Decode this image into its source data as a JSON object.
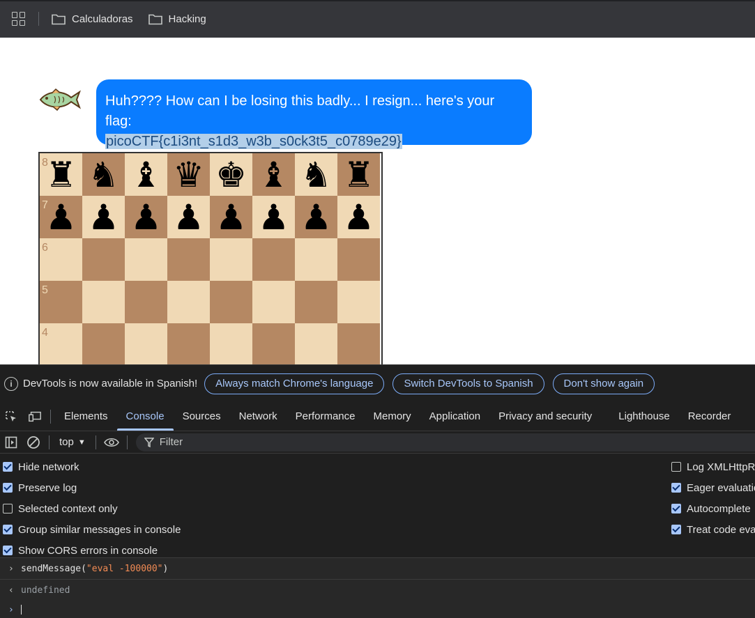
{
  "bookmarks": {
    "items": [
      {
        "label": "Calculadoras",
        "icon": "folder-icon"
      },
      {
        "label": "Hacking",
        "icon": "folder-icon"
      }
    ]
  },
  "chat": {
    "message": "Huh???? How can I be losing this badly... I resign... here's your flag:",
    "flag": "picoCTF{c1i3nt_s1d3_w3b_s0ck3t5_c0789e29}"
  },
  "board": {
    "rank_labels": [
      "8",
      "7",
      "6",
      "5",
      "4"
    ],
    "rank8": [
      "♜",
      "♞",
      "♝",
      "♛",
      "♚",
      "♝",
      "♞",
      "♜"
    ],
    "rank7": [
      "♟",
      "♟",
      "♟",
      "♟",
      "♟",
      "♟",
      "♟",
      "♟"
    ]
  },
  "devtools": {
    "info_message": "DevTools is now available in Spanish!",
    "info_buttons": [
      "Always match Chrome's language",
      "Switch DevTools to Spanish",
      "Don't show again"
    ],
    "tabs": [
      "Elements",
      "Console",
      "Sources",
      "Network",
      "Performance",
      "Memory",
      "Application",
      "Privacy and security",
      "Lighthouse",
      "Recorder"
    ],
    "active_tab": "Console",
    "context": "top",
    "filter_placeholder": "Filter",
    "settings_left": [
      {
        "label": "Hide network",
        "checked": true
      },
      {
        "label": "Preserve log",
        "checked": true
      },
      {
        "label": "Selected context only",
        "checked": false
      },
      {
        "label": "Group similar messages in console",
        "checked": true
      },
      {
        "label": "Show CORS errors in console",
        "checked": true
      }
    ],
    "settings_right": [
      {
        "label": "Log XMLHttpRe",
        "checked": false
      },
      {
        "label": "Eager evaluatio",
        "checked": true
      },
      {
        "label": "Autocomplete",
        "checked": true
      },
      {
        "label": "Treat code eval",
        "checked": true
      }
    ],
    "console": {
      "input_fn": "sendMessage(",
      "input_arg": "\"eval -100000\"",
      "input_close": ")",
      "result": "undefined"
    }
  }
}
